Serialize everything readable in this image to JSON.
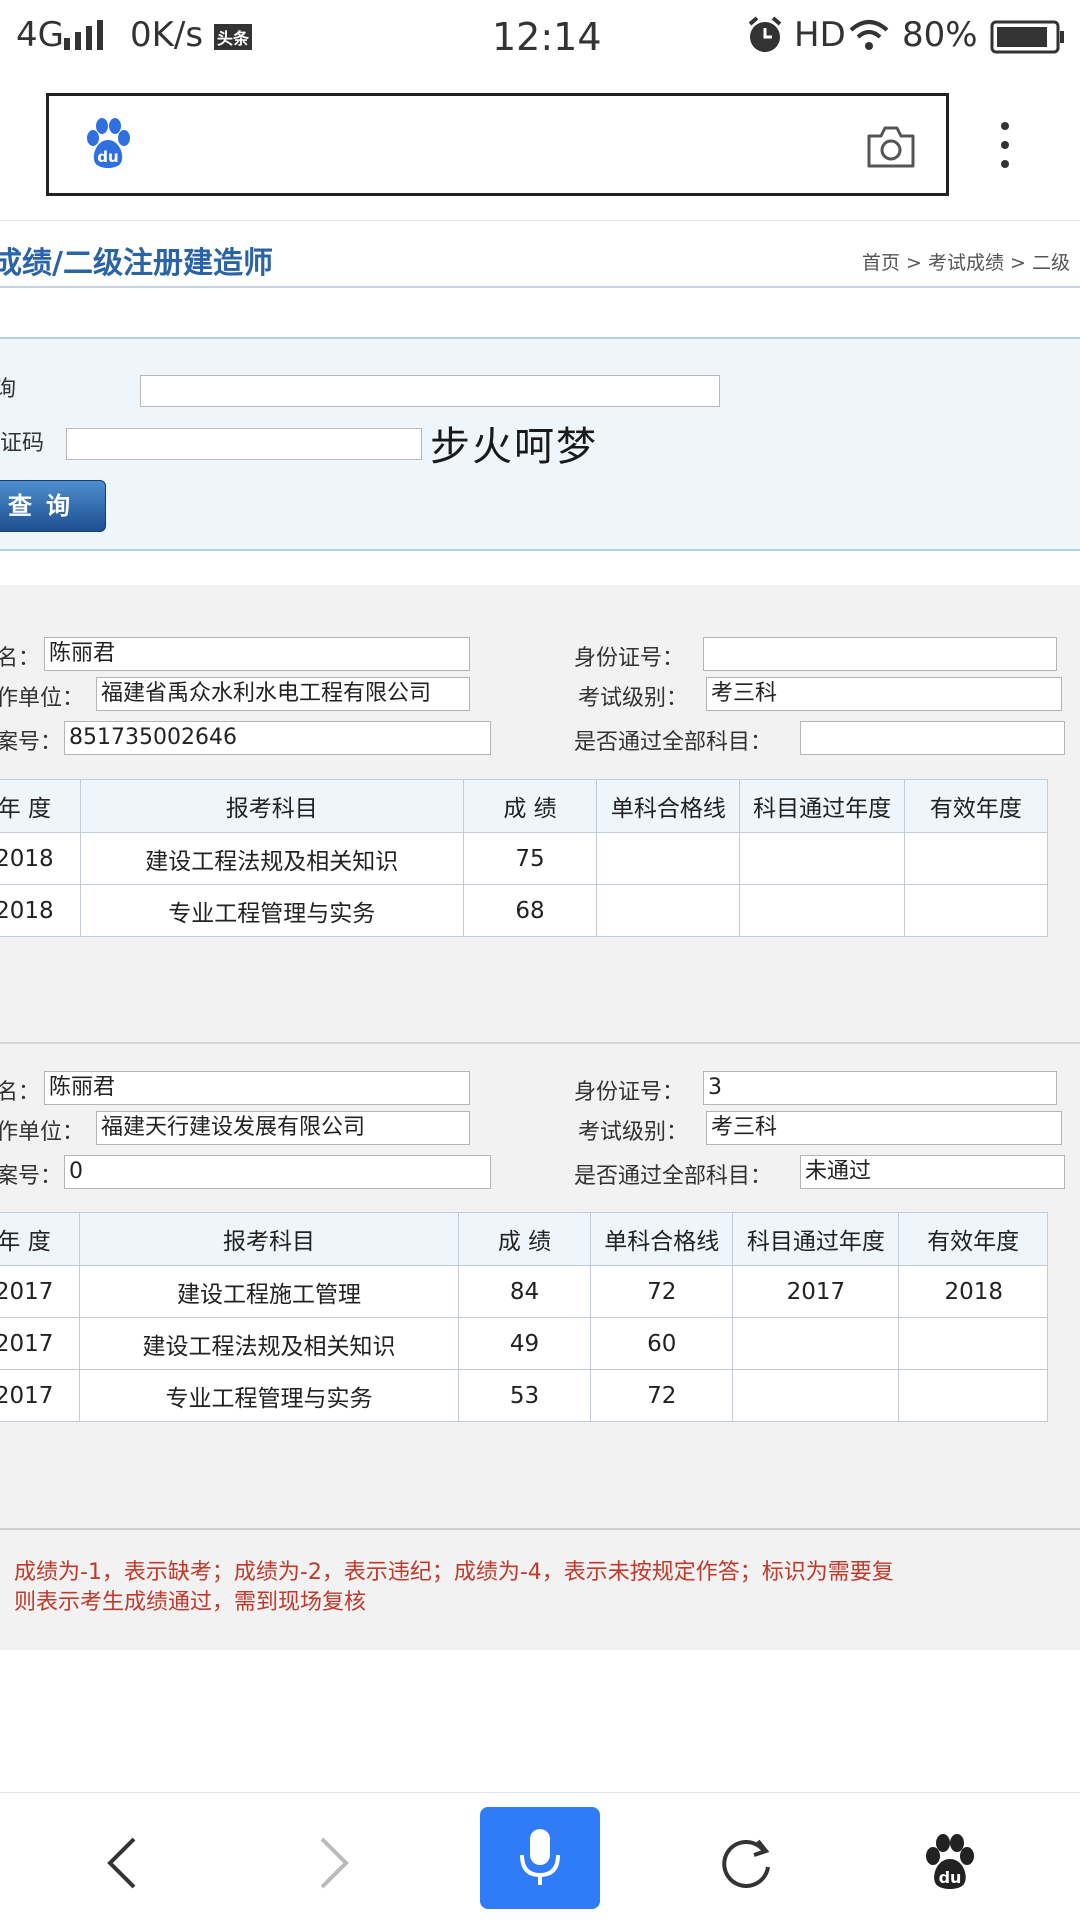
{
  "status_bar": {
    "network": "4G",
    "speed": "0K/s",
    "app_badge": "头条",
    "time": "12:14",
    "hd": "HD",
    "battery": "80%"
  },
  "browser": {
    "address_placeholder": "",
    "logo_text": "du"
  },
  "page": {
    "title": "成绩/二级注册建造师",
    "breadcrumb": "首页 > 考试成绩 > 二级"
  },
  "query_form": {
    "field1_label": "询",
    "captcha_label": "证码",
    "captcha_text": "步火呵梦",
    "button_label": "查询"
  },
  "records": [
    {
      "name_label": "名：",
      "name": "陈丽君",
      "id_label": "身份证号：",
      "id_value": "",
      "employer_label": "作单位：",
      "employer": "福建省禹众水利水电工程有限公司",
      "level_label": "考试级别：",
      "level": "考三科",
      "file_label": "案号：",
      "file_no": "851735002646",
      "pass_label": "是否通过全部科目：",
      "pass_value": "",
      "headers": [
        "年 度",
        "报考科目",
        "成 绩",
        "单科合格线",
        "科目通过年度",
        "有效年度"
      ],
      "rows": [
        [
          "2018",
          "建设工程法规及相关知识",
          "75",
          "",
          "",
          ""
        ],
        [
          "2018",
          "专业工程管理与实务",
          "68",
          "",
          "",
          ""
        ]
      ]
    },
    {
      "name_label": "名：",
      "name": "陈丽君",
      "id_label": "身份证号：",
      "id_value": "3",
      "employer_label": "作单位：",
      "employer": "福建天行建设发展有限公司",
      "level_label": "考试级别：",
      "level": "考三科",
      "file_label": "案号：",
      "file_no": "0",
      "pass_label": "是否通过全部科目：",
      "pass_value": "未通过",
      "headers": [
        "年 度",
        "报考科目",
        "成 绩",
        "单科合格线",
        "科目通过年度",
        "有效年度"
      ],
      "rows": [
        [
          "2017",
          "建设工程施工管理",
          "84",
          "72",
          "2017",
          "2018"
        ],
        [
          "2017",
          "建设工程法规及相关知识",
          "49",
          "60",
          "",
          ""
        ],
        [
          "2017",
          "专业工程管理与实务",
          "53",
          "72",
          "",
          ""
        ]
      ]
    }
  ],
  "note": {
    "line1": "成绩为-1，表示缺考；成绩为-2，表示违纪；成绩为-4，表示未按规定作答；标识为需要复",
    "line2": "则表示考生成绩通过，需到现场复核"
  },
  "colors": {
    "accent_blue": "#2a64a6",
    "mic_blue": "#2f7cf6",
    "note_red": "#c0392b",
    "panel_bg": "#eef5fb"
  },
  "icons": [
    "signal-icon",
    "alarm-icon",
    "wifi-icon",
    "battery-icon",
    "baidu-paw-icon",
    "camera-icon",
    "more-vertical-icon",
    "back-icon",
    "forward-icon",
    "microphone-icon",
    "refresh-icon",
    "baidu-home-icon"
  ]
}
